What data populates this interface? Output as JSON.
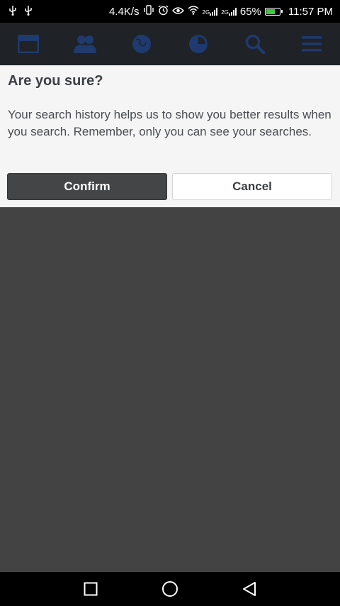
{
  "status_bar": {
    "left_icons": [
      "usb-icon",
      "usb-icon"
    ],
    "net_speed": "4.4K/s",
    "net_badge_1": "2G",
    "net_badge_2": "2G",
    "battery_percent": "65%",
    "time": "11:57 PM"
  },
  "navbar": {
    "items": [
      "news-feed-icon",
      "friends-icon",
      "globe-icon",
      "messenger-icon",
      "search-icon",
      "menu-icon"
    ]
  },
  "dialog": {
    "title": "Are you sure?",
    "message": "Your search history helps us to show you better results when you search. Remember, only you can see your searches.",
    "confirm_label": "Confirm",
    "cancel_label": "Cancel"
  },
  "system_nav": {
    "items": [
      "recents-button",
      "home-button",
      "back-button"
    ]
  },
  "colors": {
    "overlay": "#434343",
    "dialog_bg": "#f5f5f5",
    "confirm_bg": "#444547",
    "navbar_bg": "#1f2227",
    "nav_icon": "#1e3a6e",
    "battery_fill": "#3ec93e"
  }
}
